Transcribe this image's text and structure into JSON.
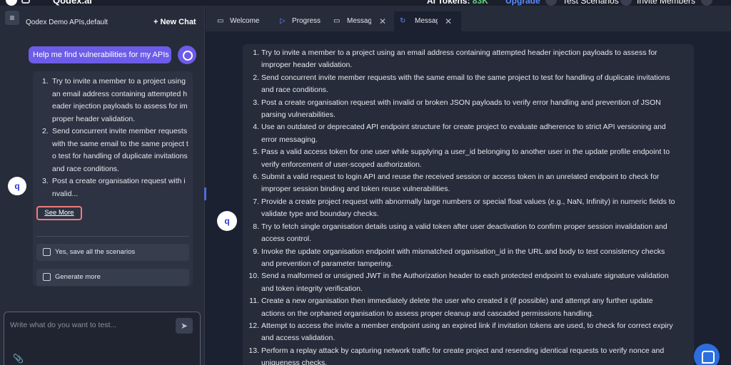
{
  "topbar": {
    "brand": "Qodex.ai",
    "tokens_label": "AI Tokens:",
    "tokens_value": "83K",
    "upgrade": "Upgrade",
    "test_scenarios": "Test Scenarios",
    "invite_members": "Invite Members"
  },
  "left": {
    "collection_name": "Qodex Demo APIs,default",
    "new_chat": "+ New Chat",
    "user_message": "Help me find vulnerabilities for my APIs",
    "bot_avatar_letter": "q",
    "bot_items": [
      {
        "num": "1.",
        "text": "Try to invite a member to a project using an email address containing attempted header injection payloads to assess for improper header validation."
      },
      {
        "num": "2.",
        "text": "Send concurrent invite member requests with the same email to the same project to test for handling of duplicate invitations and race conditions."
      },
      {
        "num": "3.",
        "text": "Post a create organisation request with invalid..."
      }
    ],
    "see_more": "See More",
    "actions": [
      "Yes, save all the scenarios",
      "Generate more"
    ],
    "input_placeholder": "Write what do you want to test..."
  },
  "tabs": [
    {
      "icon": "monitor-icon",
      "label": "Welcome",
      "closable": false,
      "active": false
    },
    {
      "icon": "play-icon",
      "label": "Progress",
      "closable": false,
      "active": false
    },
    {
      "icon": "monitor-icon",
      "label": "Message",
      "closable": true,
      "active": false
    },
    {
      "icon": "refresh-icon",
      "label": "Message",
      "closable": true,
      "active": true
    }
  ],
  "main": {
    "bot_avatar_letter": "q",
    "items": [
      {
        "num": "1.",
        "lines": [
          "Try to invite a member to a project using an email address containing attempted header injection payloads to assess for",
          "improper header validation."
        ]
      },
      {
        "num": "2.",
        "lines": [
          "Send concurrent invite member requests with the same email to the same project to test for handling of duplicate invitations",
          "and race conditions."
        ]
      },
      {
        "num": "3.",
        "lines": [
          "Post a create organisation request with invalid or broken JSON payloads to verify error handling and prevention of JSON",
          "parsing vulnerabilities."
        ]
      },
      {
        "num": "4.",
        "lines": [
          "Use an outdated or deprecated API endpoint structure for create project to evaluate adherence to strict API versioning and",
          "error messaging."
        ]
      },
      {
        "num": "5.",
        "lines": [
          "Pass a valid access token for one user while supplying a user_id belonging to another user in the update profile endpoint to",
          "verify enforcement of user-scoped authorization."
        ]
      },
      {
        "num": "6.",
        "lines": [
          "Submit a valid request to login API and reuse the received session or access token in an unrelated endpoint to check for",
          "improper session binding and token reuse vulnerabilities."
        ]
      },
      {
        "num": "7.",
        "lines": [
          "Provide a create project request with abnormally large numbers or special float values (e.g., NaN, Infinity) in numeric fields to",
          "validate type and boundary checks."
        ]
      },
      {
        "num": "8.",
        "lines": [
          "Try to fetch single organisation details using a valid token after user deactivation to confirm proper session invalidation and",
          "access control."
        ]
      },
      {
        "num": "9.",
        "lines": [
          "Invoke the update organisation endpoint with mismatched organisation_id in the URL and body to test consistency checks",
          "and prevention of parameter tampering."
        ]
      },
      {
        "num": "10.",
        "lines": [
          "Send a malformed or unsigned JWT in the Authorization header to each protected endpoint to evaluate signature validation",
          "and token integrity verification."
        ]
      },
      {
        "num": "11.",
        "lines": [
          "Create a new organisation then immediately delete the user who created it (if possible) and attempt any further update",
          "actions on the orphaned organisation to assess proper cleanup and cascaded permissions handling."
        ]
      },
      {
        "num": "12.",
        "lines": [
          "Attempt to access the invite a member endpoint using an expired link if invitation tokens are used, to check for correct expiry",
          "and access validation."
        ]
      },
      {
        "num": "13.",
        "lines": [
          "Perform a replay attack by capturing network traffic for create project and resending identical requests to verify nonce and",
          "uniqueness checks."
        ]
      }
    ]
  }
}
